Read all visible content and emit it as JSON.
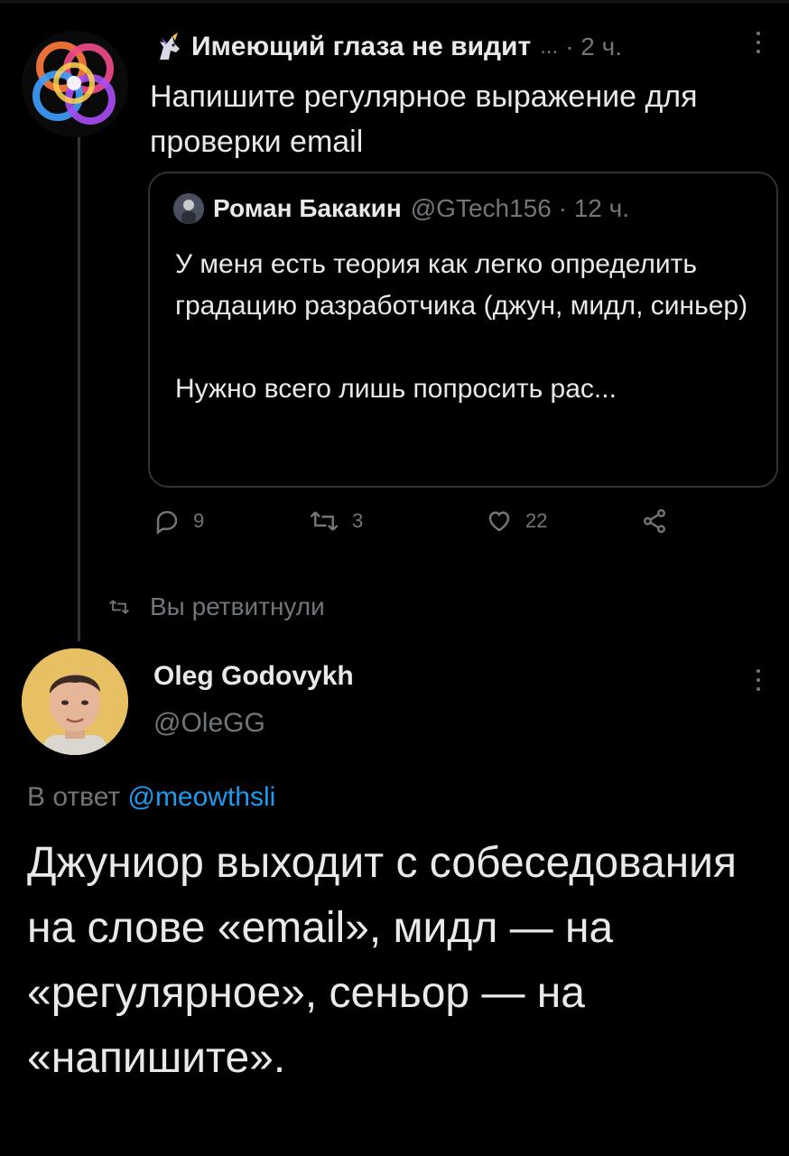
{
  "tweet1": {
    "author_name": "Имеющий глаза не видит",
    "name_truncation": "...",
    "time": "· 2 ч.",
    "text": "Напишите регулярное выражение для проверки email",
    "badge_icon": "unicorn-emoji",
    "more_icon": "more-vertical-icon"
  },
  "quote": {
    "author_name": "Роман Бакакин",
    "handle_time": "@GTech156 · 12 ч.",
    "line1": "У меня есть теория как легко определить градацию разработчика (джун, мидл, синьер)",
    "line2": "Нужно всего лишь попросить рас..."
  },
  "actions": {
    "reply_count": "9",
    "retweet_count": "3",
    "like_count": "22"
  },
  "retweet_indicator": "Вы ретвитнули",
  "tweet2": {
    "author_name": "Oleg Godovykh",
    "handle": "@OleGG",
    "reply_prefix": "В ответ",
    "reply_mention": "@meowthsli",
    "text": "Джуниор выходит с собеседования на слове «email», мидл — на «регулярное», сеньор — на «напишите».",
    "more_icon": "more-vertical-icon"
  },
  "colors": {
    "background": "#000000",
    "text": "#e7e9ea",
    "secondary": "#71767b",
    "link": "#1d9bf0",
    "border": "#2f3336"
  }
}
